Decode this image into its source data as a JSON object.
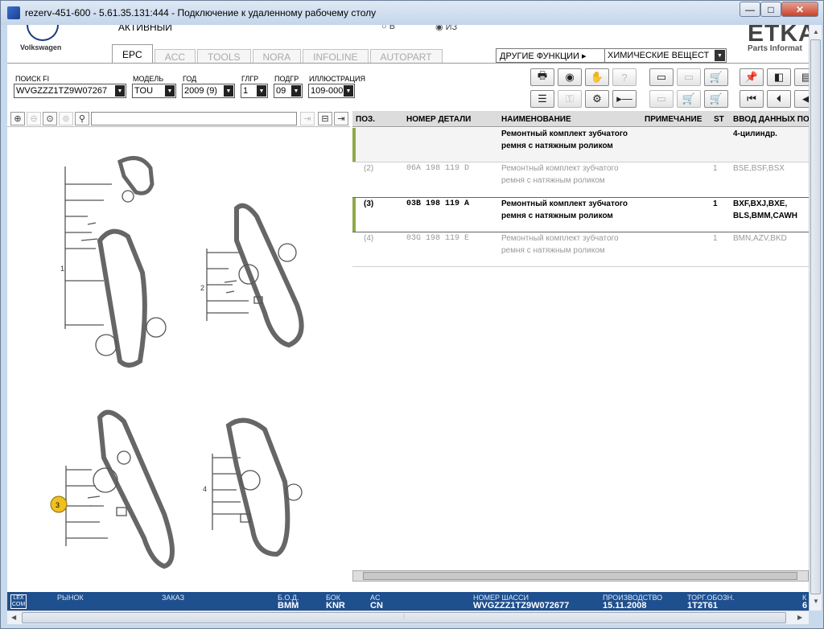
{
  "window": {
    "title": "rezerv-451-600 - 5.61.35.131:444 - Подключение к удаленному рабочему столу",
    "min": "—",
    "max": "□",
    "close": "✕"
  },
  "header": {
    "logo_text": "Volkswagen",
    "active_label": "АКТИВНЫЙ",
    "radio_b": "○ В",
    "radio_iz": "◉ ИЗ",
    "brand": "ETKA",
    "brand_sub": "Parts Informat",
    "other_functions": "ДРУГИЕ ФУНКЦИИ ▸",
    "chem_select": "ХИМИЧЕСКИЕ ВЕЩЕСТ"
  },
  "tabs": [
    "EPC",
    "ACC",
    "TOOLS",
    "NORA",
    "INFOLINE",
    "AUTOPART"
  ],
  "search": {
    "poisk_label": "ПОИСК FI",
    "poisk_value": "WVGZZZ1TZ9W07267",
    "model_label": "МОДЕЛЬ",
    "model_value": "TOU",
    "year_label": "ГОД",
    "year_value": "2009 (9)",
    "glgr_label": "ГЛГР",
    "glgr_value": "1",
    "podgr_label": "ПОДГР",
    "podgr_value": "09",
    "illu_label": "ИЛЛЮСТРАЦИЯ",
    "illu_value": "109-000"
  },
  "illustration": {
    "group_labels": [
      "1",
      "2",
      "3",
      "4"
    ],
    "highlight_label": "3"
  },
  "table": {
    "headers": {
      "pos": "ПОЗ.",
      "part": "НОМЕР ДЕТАЛИ",
      "name": "НАИМЕНОВАНИЕ",
      "note": "ПРИМЕЧАНИЕ",
      "st": "ST",
      "input": "ВВОД ДАННЫХ ПО"
    },
    "rows": [
      {
        "pos": "",
        "part": "",
        "name1": "Ремонтный комплект зубчатого",
        "name2": "ремня с натяжным роликом",
        "st": "",
        "input1": "4-цилиндр.",
        "input2": ""
      },
      {
        "pos": "(2)",
        "part": "06A  198  119  D",
        "name1": "Ремонтный комплект зубчатого",
        "name2": "ремня с натяжным роликом",
        "st": "1",
        "input1": "BSE,BSF,BSX",
        "input2": ""
      },
      {
        "pos": "(3)",
        "part": "03B  198  119  A",
        "name1": "Ремонтный комплект зубчатого",
        "name2": "ремня с натяжным роликом",
        "st": "1",
        "input1": "BXF,BXJ,BXE,",
        "input2": "BLS,BMM,CAWH"
      },
      {
        "pos": "(4)",
        "part": "03G  198  119  E",
        "name1": "Ремонтный комплект зубчатого",
        "name2": "ремня с натяжным роликом",
        "st": "1",
        "input1": "BMN,AZV,BKD",
        "input2": ""
      }
    ]
  },
  "status": {
    "lex": "LEX COM",
    "market_label": "РЫНОК",
    "order_label": "ЗАКАЗ",
    "bod_label": "Б.О.Д.",
    "bod_value": "BMM",
    "bok_label": "БОК",
    "bok_value": "KNR",
    "ac_label": "AC",
    "ac_value": "CN",
    "chassis_label": "НОМЕР ШАССИ",
    "chassis_value": "WVGZZZ1TZ9W072677",
    "prod_label": "ПРОИЗВОДСТВО",
    "prod_value": "15.11.2008",
    "trade_label": "ТОРГ.ОБОЗН.",
    "trade_value": "1T2T61",
    "extra_label": "К",
    "extra_value": "6"
  }
}
